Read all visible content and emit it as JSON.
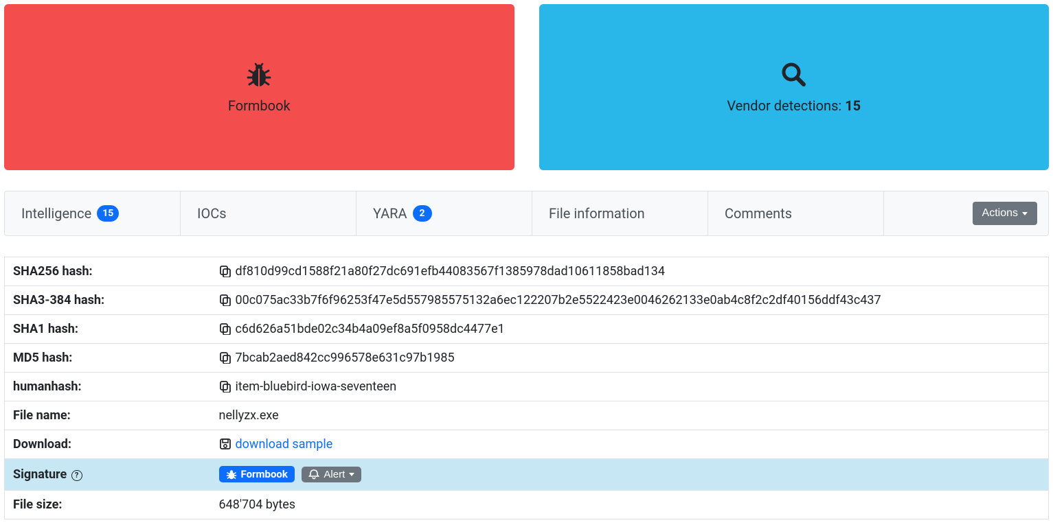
{
  "cards": {
    "malware": {
      "name": "Formbook"
    },
    "detections": {
      "label": "Vendor detections: ",
      "count": "15"
    }
  },
  "tabs": {
    "intelligence": {
      "label": "Intelligence",
      "badge": "15"
    },
    "iocs": {
      "label": "IOCs"
    },
    "yara": {
      "label": "YARA",
      "badge": "2"
    },
    "fileinfo": {
      "label": "File information"
    },
    "comments": {
      "label": "Comments"
    },
    "actions_label": "Actions"
  },
  "rows": {
    "sha256": {
      "label": "SHA256 hash:",
      "value": "df810d99cd1588f21a80f27dc691efb44083567f1385978dad10611858bad134"
    },
    "sha3_384": {
      "label": "SHA3-384 hash:",
      "value": "00c075ac33b7f6f96253f47e5d557985575132a6ec122207b2e5522423e0046262133e0ab4c8f2c2df40156ddf43c437"
    },
    "sha1": {
      "label": "SHA1 hash:",
      "value": "c6d626a51bde02c34b4a09ef8a5f0958dc4477e1"
    },
    "md5": {
      "label": "MD5 hash:",
      "value": "7bcab2aed842cc996578e631c97b1985"
    },
    "humanhash": {
      "label": "humanhash:",
      "value": "item-bluebird-iowa-seventeen"
    },
    "filename": {
      "label": "File name:",
      "value": "nellyzx.exe"
    },
    "download": {
      "label": "Download:",
      "link_text": "download sample"
    },
    "signature": {
      "label": "Signature ",
      "badge": "Formbook",
      "alert": "Alert"
    },
    "filesize": {
      "label": "File size:",
      "value": "648'704 bytes"
    }
  }
}
